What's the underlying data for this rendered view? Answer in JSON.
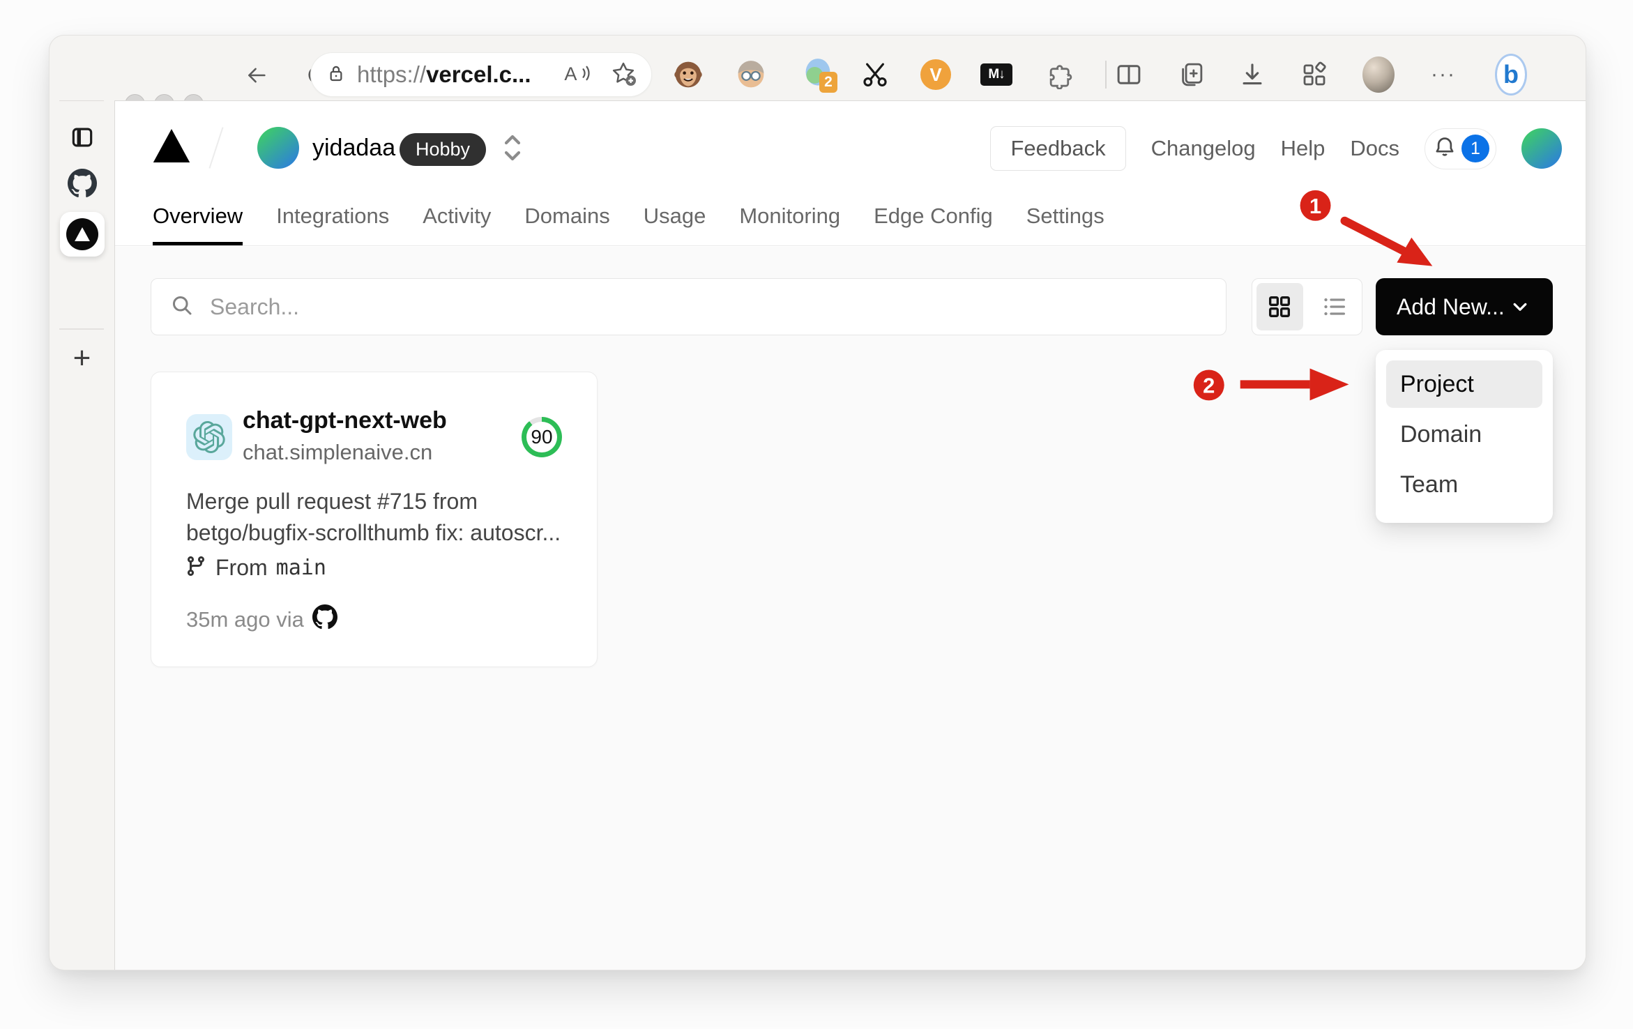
{
  "browser": {
    "url": {
      "scheme": "https://",
      "domain": "vercel.c..."
    },
    "extension_badge": "2",
    "markdown_label": "M↓",
    "v_label": "V",
    "bing_label": "b",
    "more_label": "···"
  },
  "header": {
    "team_name": "yidadaa",
    "plan_badge": "Hobby",
    "feedback": "Feedback",
    "changelog": "Changelog",
    "help": "Help",
    "docs": "Docs",
    "notification_count": "1"
  },
  "tabs": [
    {
      "label": "Overview"
    },
    {
      "label": "Integrations"
    },
    {
      "label": "Activity"
    },
    {
      "label": "Domains"
    },
    {
      "label": "Usage"
    },
    {
      "label": "Monitoring"
    },
    {
      "label": "Edge Config"
    },
    {
      "label": "Settings"
    }
  ],
  "controls": {
    "search_placeholder": "Search...",
    "add_new": "Add New..."
  },
  "dropdown": {
    "project": "Project",
    "domain": "Domain",
    "team": "Team"
  },
  "card": {
    "name": "chat-gpt-next-web",
    "domain": "chat.simplenaive.cn",
    "score": "90",
    "commit": "Merge pull request #715 from betgo/bugfix-scrollthumb fix: autoscr...",
    "from_label": "From",
    "branch": "main",
    "time": "35m ago via"
  },
  "annotations": {
    "step1": "1",
    "step2": "2"
  },
  "colors": {
    "accent_red": "#d92318",
    "score_green": "#2dbd56",
    "badge_blue": "#0b72e7"
  }
}
